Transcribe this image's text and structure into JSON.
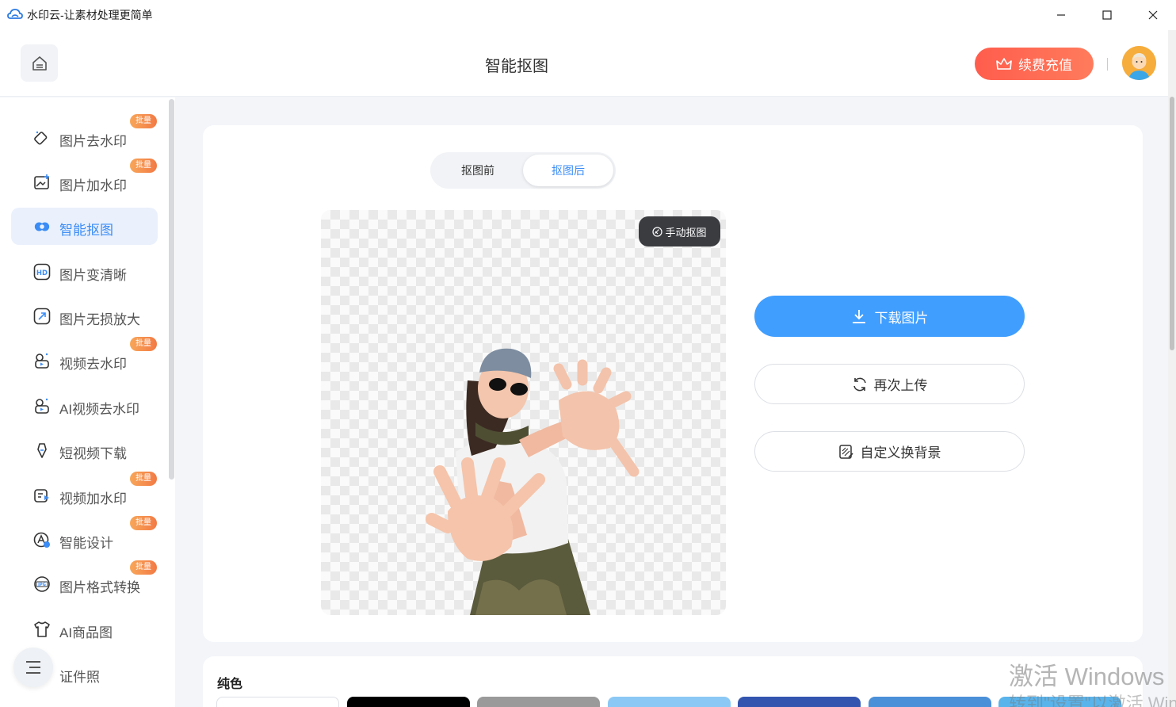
{
  "window": {
    "title": "水印云-让素材处理更简单",
    "controls": [
      "minimize-icon",
      "maximize-icon",
      "close-icon"
    ]
  },
  "header": {
    "page_title": "智能抠图",
    "recharge_label": "续费充值"
  },
  "sidebar": {
    "items": [
      {
        "label": "图片去水印",
        "badge": "批量",
        "active": false
      },
      {
        "label": "图片加水印",
        "badge": "批量",
        "active": false
      },
      {
        "label": "智能抠图",
        "badge": "",
        "active": true
      },
      {
        "label": "图片变清晰",
        "badge": "",
        "active": false
      },
      {
        "label": "图片无损放大",
        "badge": "",
        "active": false
      },
      {
        "label": "视频去水印",
        "badge": "批量",
        "active": false
      },
      {
        "label": "AI视频去水印",
        "badge": "",
        "active": false
      },
      {
        "label": "短视频下载",
        "badge": "",
        "active": false
      },
      {
        "label": "视频加水印",
        "badge": "批量",
        "active": false
      },
      {
        "label": "智能设计",
        "badge": "批量",
        "active": false
      },
      {
        "label": "图片格式转换",
        "badge": "批量",
        "active": false
      },
      {
        "label": "AI商品图",
        "badge": "",
        "active": false
      },
      {
        "label": "证件照",
        "badge": "",
        "active": false
      }
    ]
  },
  "editor": {
    "toggle_before": "抠图前",
    "toggle_after": "抠图后",
    "toggle_selected": "抠图后",
    "manual_label": "手动抠图",
    "download_label": "下载图片",
    "reupload_label": "再次上传",
    "custom_bg_label": "自定义换背景"
  },
  "colors": {
    "section_title": "纯色",
    "swatches": [
      "#ffffff",
      "#000000",
      "#9a9a9a",
      "#8cc8f5",
      "#3355b0",
      "#4a90d9",
      "#5ab4ec"
    ]
  },
  "watermark": {
    "line1": "激活 Windows",
    "line2": "转到\"设置\"以激活 Windows。"
  },
  "accent": "#409eff"
}
